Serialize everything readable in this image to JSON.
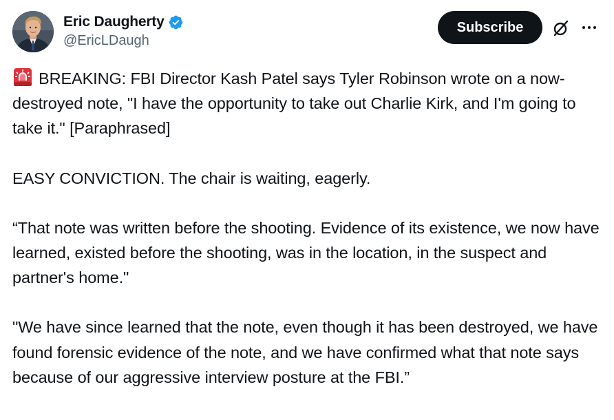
{
  "author": {
    "display_name": "Eric Daugherty",
    "handle": "@EricLDaugh",
    "verified": true,
    "avatar_icon": "profile-photo"
  },
  "actions": {
    "subscribe_label": "Subscribe",
    "grok_icon": "grok-icon",
    "more_icon": "more-icon"
  },
  "colors": {
    "verified_blue": "#1d9bf0",
    "text_primary": "#0f1419",
    "text_secondary": "#536471",
    "button_bg": "#0f1419",
    "siren_red": "#e0313c"
  },
  "post": {
    "emoji": "siren-icon",
    "paragraphs": [
      "BREAKING: FBI Director Kash Patel says Tyler Robinson wrote on a now-destroyed note, \"I have the opportunity to take out Charlie Kirk, and I'm going to take it.\" [Paraphrased]",
      "EASY CONVICTION. The chair is waiting, eagerly.",
      "“That note was written before the shooting. Evidence of its existence, we now have learned, existed before the shooting, was in the location, in the suspect and partner's home.\"",
      "\"We have since learned that the note, even though it has been destroyed, we have found forensic evidence of the note, and we have confirmed what that note says because of our aggressive interview posture at the FBI.”"
    ]
  }
}
